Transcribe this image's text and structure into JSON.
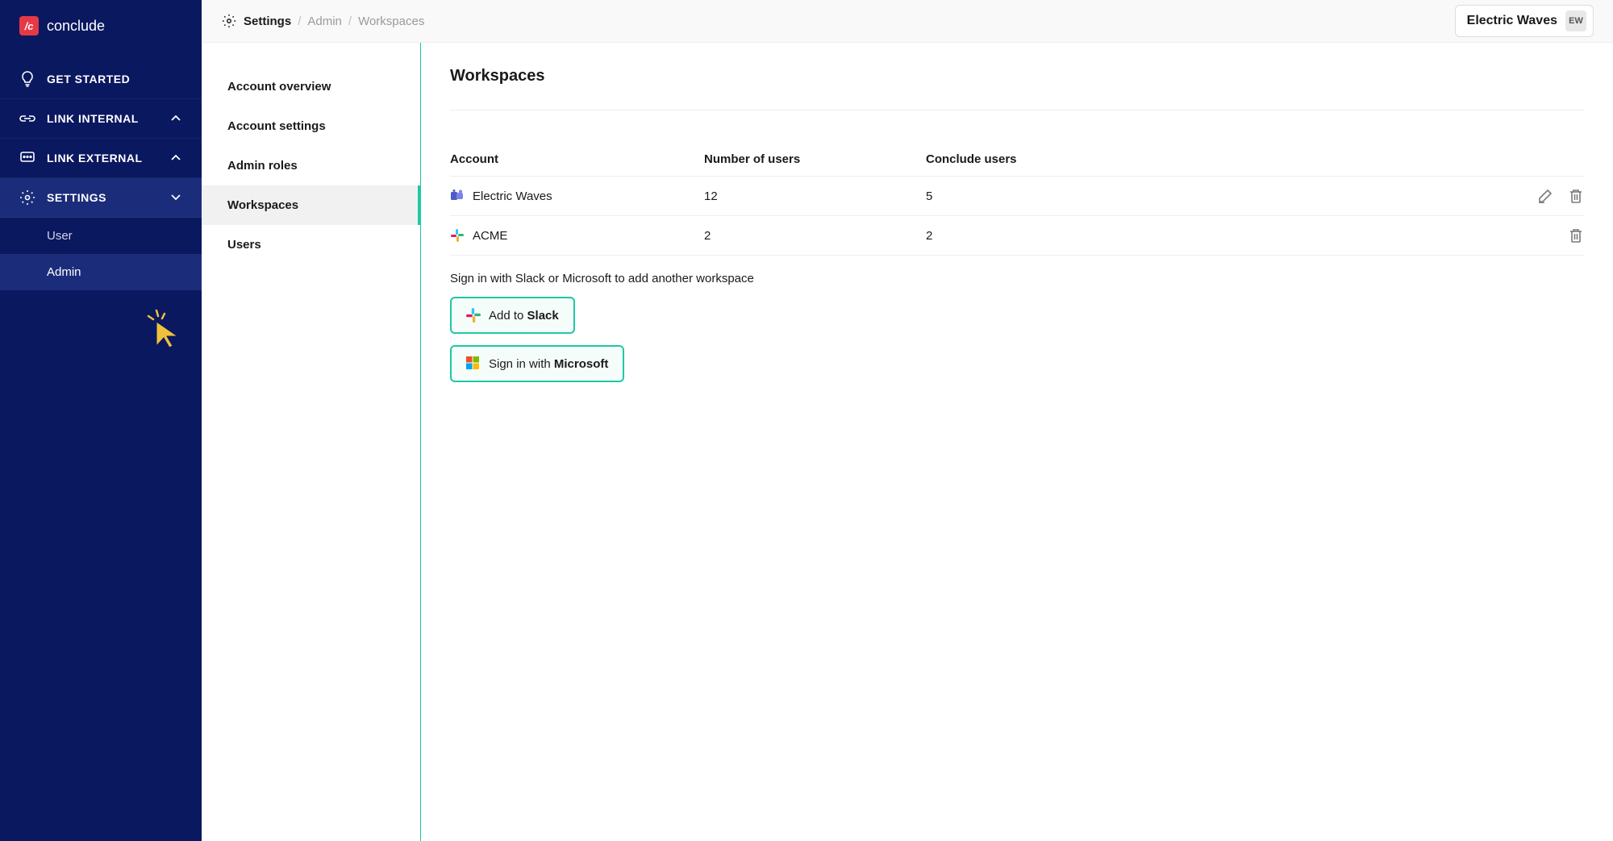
{
  "brand": {
    "name": "conclude",
    "logo_text": "/c"
  },
  "sidebar": {
    "items": [
      {
        "label": "Get Started",
        "icon": "lightbulb"
      },
      {
        "label": "Link Internal",
        "icon": "link",
        "chevron": "up"
      },
      {
        "label": "Link External",
        "icon": "message",
        "chevron": "up"
      },
      {
        "label": "Settings",
        "icon": "gear",
        "chevron": "down",
        "active": true
      }
    ],
    "sub_items": [
      {
        "label": "User"
      },
      {
        "label": "Admin",
        "active": true
      }
    ]
  },
  "breadcrumbs": {
    "root": "Settings",
    "mid": "Admin",
    "leaf": "Workspaces",
    "sep": "/"
  },
  "account_switch": {
    "name": "Electric Waves",
    "initials": "EW"
  },
  "subnav": {
    "items": [
      {
        "label": "Account overview"
      },
      {
        "label": "Account settings"
      },
      {
        "label": "Admin roles"
      },
      {
        "label": "Workspaces",
        "active": true
      },
      {
        "label": "Users"
      }
    ]
  },
  "page": {
    "title": "Workspaces"
  },
  "table": {
    "headers": {
      "account": "Account",
      "users": "Number of users",
      "conclude": "Conclude users"
    },
    "rows": [
      {
        "provider": "teams",
        "name": "Electric Waves",
        "users": "12",
        "conclude": "5",
        "editable": true
      },
      {
        "provider": "slack",
        "name": "ACME",
        "users": "2",
        "conclude": "2",
        "editable": false
      }
    ]
  },
  "add_workspace": {
    "hint": "Sign in with Slack or Microsoft to add another workspace",
    "slack_prefix": "Add to ",
    "slack_brand": "Slack",
    "ms_prefix": "Sign in with ",
    "ms_brand": "Microsoft"
  }
}
